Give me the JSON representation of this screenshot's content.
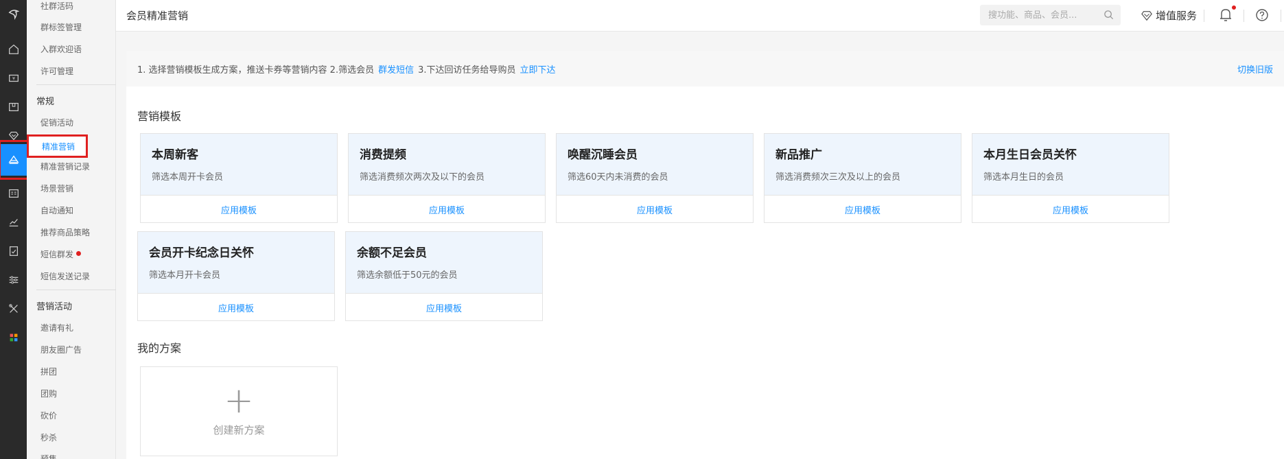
{
  "topbar": {
    "page_title": "会员精准营销",
    "search_placeholder": "搜功能、商品、会员...",
    "value_added_label": "增值服务"
  },
  "submenu": {
    "items_top": [
      "社群活码",
      "群标签管理",
      "入群欢迎语",
      "许可管理"
    ],
    "section_general": "常规",
    "general_items": [
      "促销活动",
      "精准营销",
      "精准营销记录",
      "场景营销",
      "自动通知",
      "推荐商品策略",
      "短信群发",
      "短信发送记录"
    ],
    "section_marketing": "营销活动",
    "marketing_items": [
      "邀请有礼",
      "朋友圈广告",
      "拼团",
      "团购",
      "砍价",
      "秒杀",
      "预售"
    ]
  },
  "notice": {
    "part1": "1. 选择营销模板生成方案，推送卡券等营销内容 2.筛选会员",
    "link1": "群发短信",
    "part2": "3.下达回访任务给导购员",
    "link2": "立即下达",
    "switch_old": "切换旧版"
  },
  "templates_section": "营销模板",
  "templates": [
    {
      "name": "本周新客",
      "desc": "筛选本周开卡会员",
      "action": "应用模板"
    },
    {
      "name": "消费提频",
      "desc": "筛选消费频次两次及以下的会员",
      "action": "应用模板"
    },
    {
      "name": "唤醒沉睡会员",
      "desc": "筛选60天内未消费的会员",
      "action": "应用模板"
    },
    {
      "name": "新品推广",
      "desc": "筛选消费频次三次及以上的会员",
      "action": "应用模板"
    },
    {
      "name": "本月生日会员关怀",
      "desc": "筛选本月生日的会员",
      "action": "应用模板"
    },
    {
      "name": "会员开卡纪念日关怀",
      "desc": "筛选本月开卡会员",
      "action": "应用模板"
    },
    {
      "name": "余额不足会员",
      "desc": "筛选余额低于50元的会员",
      "action": "应用模板"
    }
  ],
  "plans_section": "我的方案",
  "new_plan_label": "创建新方案",
  "colors": {
    "accent": "#1890ff",
    "highlight": "#e02020",
    "rail": "#2a2a2a"
  }
}
